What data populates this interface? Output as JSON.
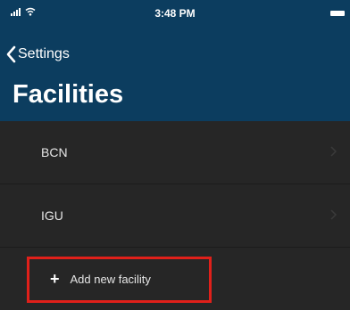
{
  "status_bar": {
    "time": "3:48 PM"
  },
  "nav": {
    "back_label": "Settings",
    "title": "Facilities"
  },
  "facilities": [
    {
      "label": "BCN"
    },
    {
      "label": "IGU"
    }
  ],
  "add_action": {
    "label": "Add new facility",
    "icon": "plus-icon"
  },
  "colors": {
    "header": "#0c3d5f",
    "background": "#262626",
    "highlight": "#e0201a"
  }
}
